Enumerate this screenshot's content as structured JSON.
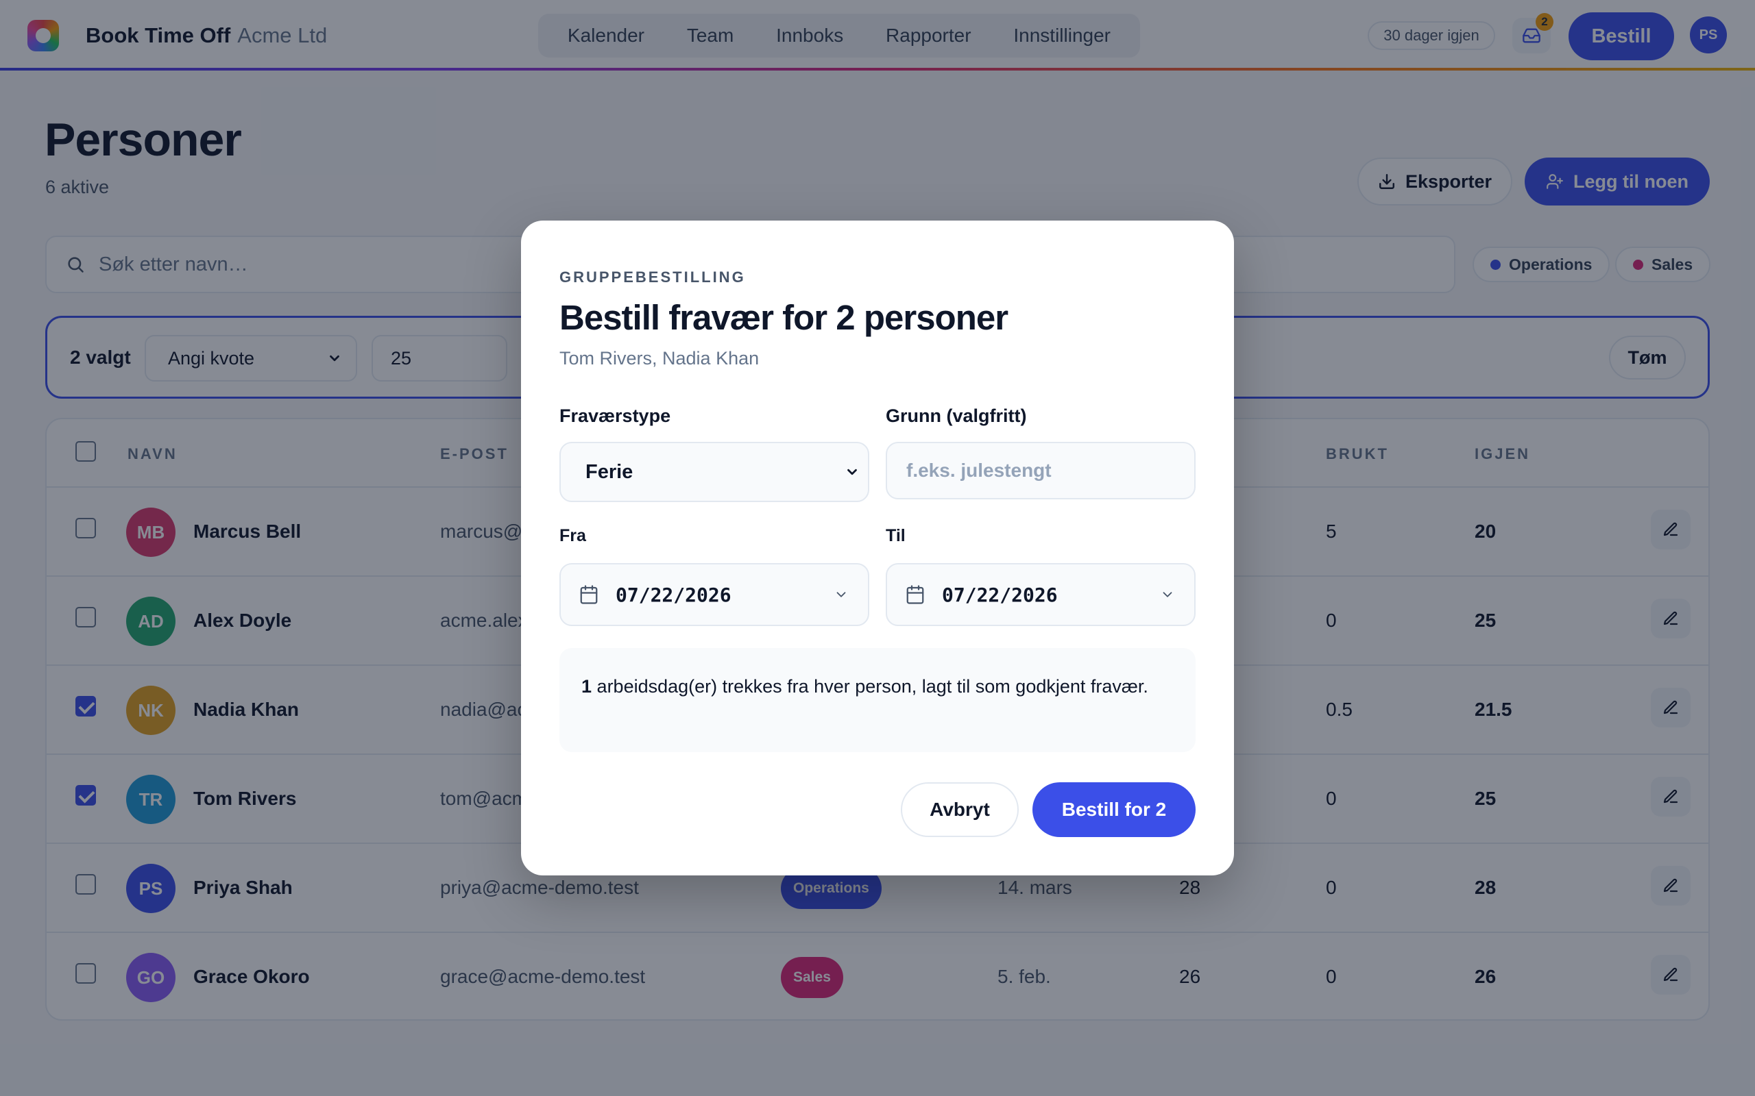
{
  "app": {
    "brand": "Book Time Off",
    "org": "Acme Ltd"
  },
  "nav": [
    "Kalender",
    "Team",
    "Innboks",
    "Rapporter",
    "Innstillinger"
  ],
  "header": {
    "trial": "30 dager igjen",
    "inbox_count": "2",
    "book_label": "Bestill",
    "user_initials": "PS"
  },
  "page": {
    "title": "Personer",
    "subtitle": "6 aktive",
    "export_label": "Eksporter",
    "add_label": "Legg til noen"
  },
  "search": {
    "placeholder": "Søk etter navn…"
  },
  "filters": [
    {
      "label": "Operations",
      "color": "#3b4fe8"
    },
    {
      "label": "Sales",
      "color": "#db2777"
    }
  ],
  "bulk": {
    "count": "2 valgt",
    "action": "Angi kvote",
    "value": "25",
    "clear_label": "Tøm"
  },
  "table": {
    "columns": {
      "name": "NAVN",
      "email": "E-POST",
      "used": "BRUKT",
      "left": "IGJEN"
    },
    "rows": [
      {
        "initials": "MB",
        "name": "Marcus Bell",
        "email": "marcus@",
        "team": "",
        "start": "",
        "quota": "",
        "used": "5",
        "left": "20",
        "checked": false,
        "color": "#d9396c"
      },
      {
        "initials": "AD",
        "name": "Alex Doyle",
        "email": "acme.alex",
        "team": "",
        "start": "",
        "quota": "",
        "used": "0",
        "left": "25",
        "checked": false,
        "color": "#22a66e"
      },
      {
        "initials": "NK",
        "name": "Nadia Khan",
        "email": "nadia@ac",
        "team": "",
        "start": "",
        "quota": "",
        "used": "0.5",
        "left": "21.5",
        "checked": true,
        "color": "#e0a020"
      },
      {
        "initials": "TR",
        "name": "Tom Rivers",
        "email": "tom@acm",
        "team": "",
        "start": "",
        "quota": "",
        "used": "0",
        "left": "25",
        "checked": true,
        "color": "#1e9ad6"
      },
      {
        "initials": "PS",
        "name": "Priya Shah",
        "email": "priya@acme-demo.test",
        "team": "Operations",
        "team_color": "#3b4fe8",
        "start": "14. mars",
        "quota": "28",
        "used": "0",
        "left": "28",
        "checked": false,
        "color": "#3b4fe8"
      },
      {
        "initials": "GO",
        "name": "Grace Okoro",
        "email": "grace@acme-demo.test",
        "team": "Sales",
        "team_color": "#db2777",
        "start": "5. feb.",
        "quota": "26",
        "used": "0",
        "left": "26",
        "checked": false,
        "color": "#8b5cf6"
      }
    ]
  },
  "modal": {
    "eyebrow": "GRUPPEBESTILLING",
    "title": "Bestill fravær for 2 personer",
    "names": "Tom Rivers, Nadia Khan",
    "type_label": "Fraværstype",
    "type_value": "Ferie",
    "reason_label": "Grunn (valgfritt)",
    "reason_placeholder": "f.eks. julestengt",
    "from_label": "Fra",
    "from_value": "07/22/2026",
    "to_label": "Til",
    "to_value": "07/22/2026",
    "info_days": "1",
    "info_text": "arbeidsdag(er) trekkes fra hver person, lagt til som godkjent fravær.",
    "cancel_label": "Avbryt",
    "submit_label": "Bestill for 2"
  }
}
